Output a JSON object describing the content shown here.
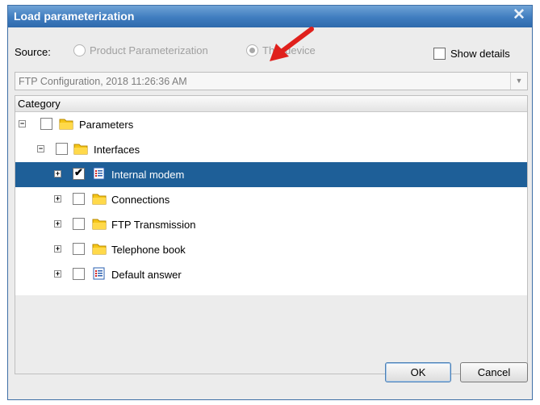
{
  "dialog": {
    "title": "Load parameterization",
    "close_glyph": "✕"
  },
  "source": {
    "label": "Source:",
    "options": [
      {
        "label": "Product Parameterization",
        "selected": false,
        "enabled": false
      },
      {
        "label": "This device",
        "selected": true,
        "enabled": false
      }
    ],
    "show_details_label": "Show details",
    "show_details_checked": false
  },
  "combo": {
    "value": "FTP Configuration, 2018 11:26:36 AM",
    "arrow_glyph": "▼"
  },
  "grid": {
    "column_header": "Category",
    "rows": [
      {
        "label": "Parameters",
        "expander": "−",
        "icon": "folder-icon",
        "checked": false,
        "selected": false
      },
      {
        "label": "Interfaces",
        "expander": "−",
        "icon": "folder-icon",
        "checked": false,
        "selected": false
      },
      {
        "label": "Internal modem",
        "expander": "+",
        "icon": "list-icon",
        "checked": true,
        "selected": true
      },
      {
        "label": "Connections",
        "expander": "+",
        "icon": "folder-icon",
        "checked": false,
        "selected": false
      },
      {
        "label": "FTP Transmission",
        "expander": "+",
        "icon": "folder-icon",
        "checked": false,
        "selected": false
      },
      {
        "label": "Telephone book",
        "expander": "+",
        "icon": "folder-icon",
        "checked": false,
        "selected": false
      },
      {
        "label": "Default answer",
        "expander": "+",
        "icon": "list-icon",
        "checked": false,
        "selected": false
      }
    ]
  },
  "buttons": {
    "ok": "OK",
    "cancel": "Cancel"
  },
  "colors": {
    "title_bar": "#3f7cbf",
    "selection": "#1e5f98",
    "annotation_arrow": "#e0201c",
    "folder": "#f5c518"
  },
  "checkmark_glyph": "✔"
}
